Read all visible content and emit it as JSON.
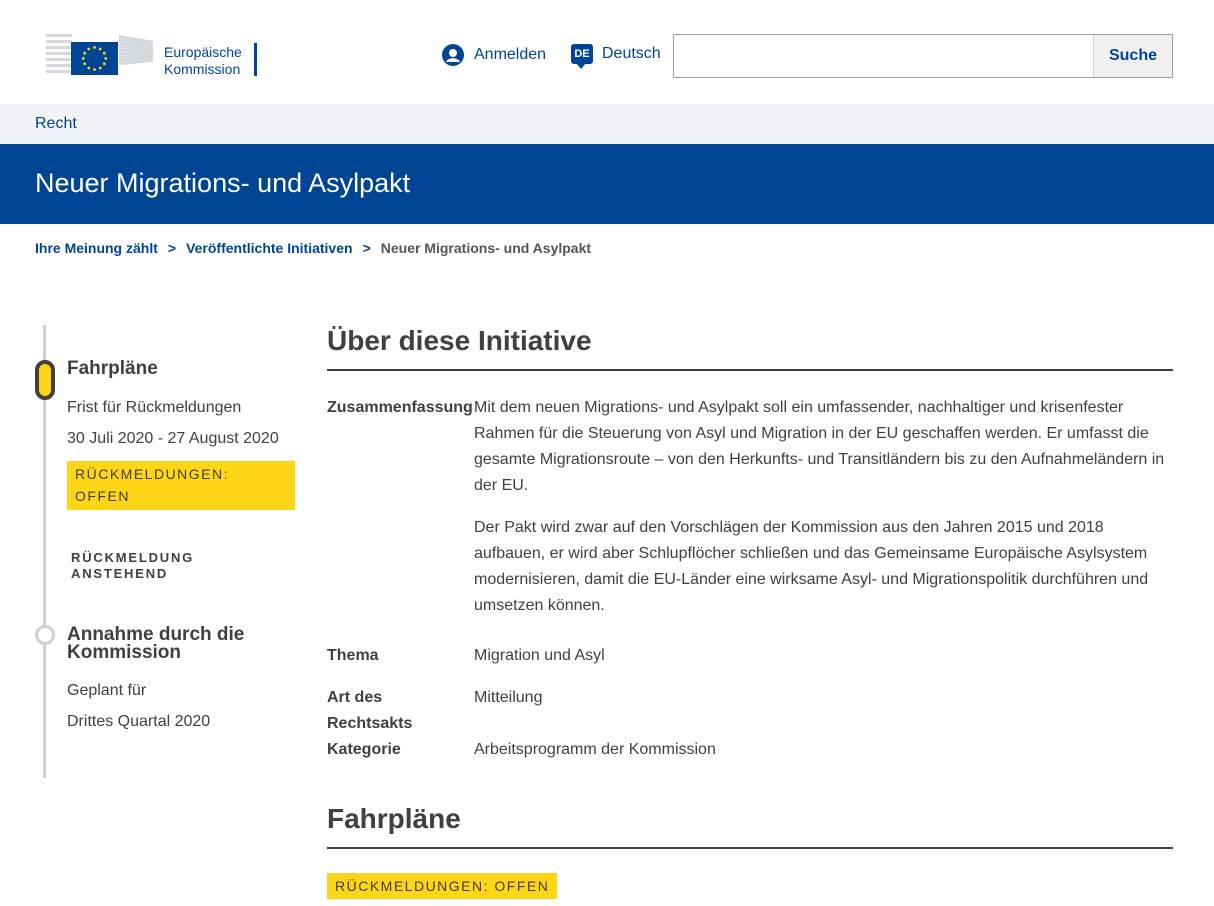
{
  "header": {
    "logo_line1": "Europäische",
    "logo_line2": "Kommission",
    "login_label": "Anmelden",
    "language_code": "DE",
    "language_label": "Deutsch",
    "search_placeholder": "",
    "search_button": "Suche"
  },
  "site_nav": {
    "label": "Recht"
  },
  "page": {
    "title": "Neuer Migrations- und Asylpakt"
  },
  "breadcrumb": {
    "items": [
      "Ihre Meinung zählt",
      "Veröffentlichte Initiativen",
      "Neuer Migrations- und Asylpakt"
    ],
    "separator": ">"
  },
  "timeline": {
    "stage1": {
      "title": "Fahrpläne",
      "deadline_label": "Frist für Rückmeldungen",
      "dates": "30 Juli 2020 - 27 August 2020",
      "badge_line1": "RÜCKMELDUNGEN:",
      "badge_line2": "OFFEN",
      "status_line1": "RÜCKMELDUNG",
      "status_line2": "ANSTEHEND"
    },
    "stage2": {
      "title_line1": "Annahme durch die",
      "title_line2": "Kommission",
      "planned_label": "Geplant für",
      "planned_value": "Drittes Quartal 2020"
    }
  },
  "about": {
    "heading": "Über diese Initiative",
    "summary_label": "Zusammenfassung",
    "summary_p1": "Mit dem neuen Migrations- und Asylpakt soll ein umfassender, nachhaltiger und krisenfester Rahmen für die Steuerung von Asyl und Migration in der EU geschaffen werden. Er umfasst die gesamte Migrationsroute – von den Herkunfts- und Transitländern bis zu den Aufnahmeländern in der EU.",
    "summary_p2": "Der Pakt wird zwar auf den Vorschlägen der Kommission aus den Jahren 2015 und 2018 aufbauen, er wird aber Schlupflöcher schließen und das Gemeinsame Europäische Asylsystem modernisieren, damit die EU-Länder eine wirksame Asyl- und Migrationspolitik durchführen und umsetzen können.",
    "topic_label": "Thema",
    "topic_value": "Migration und Asyl",
    "act_label_line1": "Art des",
    "act_label_line2": "Rechtsakts",
    "act_value": "Mitteilung",
    "category_label": "Kategorie",
    "category_value": "Arbeitsprogramm der Kommission"
  },
  "roadmaps": {
    "heading": "Fahrpläne",
    "badge": "RÜCKMELDUNGEN: OFFEN"
  },
  "colors": {
    "primary": "#004494",
    "yellow": "#ffd617",
    "text": "#404040",
    "light_bg": "#f2f4f7"
  }
}
